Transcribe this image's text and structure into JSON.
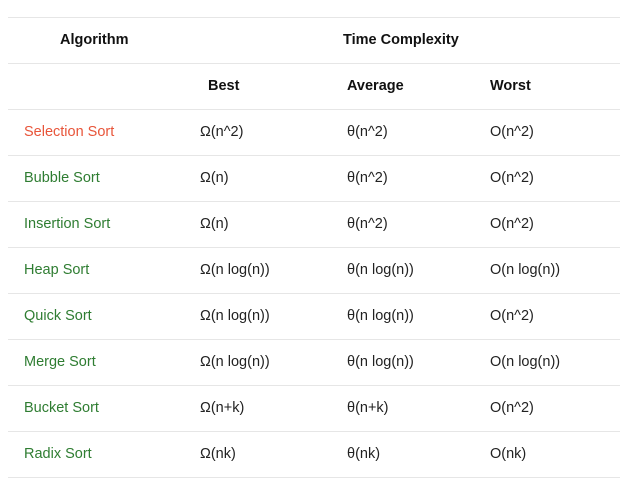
{
  "header": {
    "algorithm": "Algorithm",
    "time_complexity": "Time Complexity",
    "best": "Best",
    "average": "Average",
    "worst": "Worst"
  },
  "colors": {
    "link": "#2f7d32",
    "active_link": "#e8553a",
    "divider": "#e6e6e6"
  },
  "rows": [
    {
      "name": "Selection Sort",
      "best": "Ω(n^2)",
      "average": "θ(n^2)",
      "worst": "O(n^2)",
      "active": true
    },
    {
      "name": "Bubble Sort",
      "best": "Ω(n)",
      "average": "θ(n^2)",
      "worst": "O(n^2)"
    },
    {
      "name": "Insertion Sort",
      "best": "Ω(n)",
      "average": "θ(n^2)",
      "worst": "O(n^2)"
    },
    {
      "name": "Heap Sort",
      "best": "Ω(n log(n))",
      "average": "θ(n log(n))",
      "worst": "O(n log(n))"
    },
    {
      "name": "Quick Sort",
      "best": "Ω(n log(n))",
      "average": "θ(n log(n))",
      "worst": "O(n^2)"
    },
    {
      "name": "Merge Sort",
      "best": "Ω(n log(n))",
      "average": "θ(n log(n))",
      "worst": "O(n log(n))"
    },
    {
      "name": "Bucket Sort",
      "best": "Ω(n+k)",
      "average": "θ(n+k)",
      "worst": "O(n^2)"
    },
    {
      "name": "Radix Sort",
      "best": "Ω(nk)",
      "average": "θ(nk)",
      "worst": "O(nk)"
    }
  ]
}
